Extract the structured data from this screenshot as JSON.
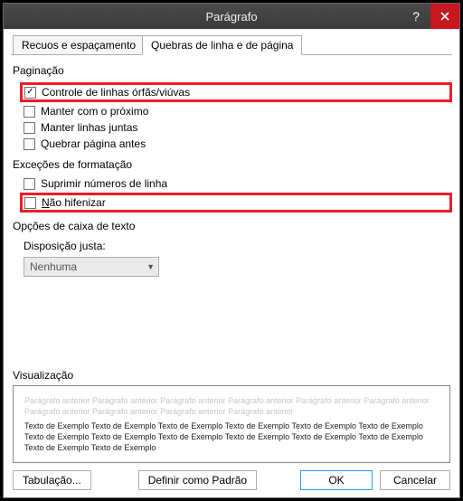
{
  "titlebar": {
    "title": "Parágrafo"
  },
  "tabs": {
    "indent": "Recuos e espaçamento",
    "breaks": "Quebras de linha e de página"
  },
  "section": {
    "pagination": "Paginação",
    "exceptions": "Exceções de formatação",
    "textbox": "Opções de caixa de texto",
    "preview": "Visualização"
  },
  "checkbox": {
    "widow": "Controle de linhas órfãs/viúvas",
    "keepnext": "Manter com o próximo",
    "keeplines": "Manter linhas juntas",
    "pagebreak": "Quebrar página antes",
    "suppress": "Suprimir números de linha",
    "nohyphen_pre": "N",
    "nohyphen_post": "ão hifenizar"
  },
  "textbox": {
    "tightwrap_label": "Disposição justa:",
    "tightwrap_value": "Nenhuma"
  },
  "preview": {
    "ghost": "Parágrafo anterior Parágrafo anterior Parágrafo anterior Parágrafo anterior Parágrafo anterior Parágrafo anterior Parágrafo anterior Parágrafo anterior Parágrafo anterior Parágrafo anterior",
    "sample": "Texto de Exemplo Texto de Exemplo Texto de Exemplo Texto de Exemplo Texto de Exemplo Texto de Exemplo Texto de Exemplo Texto de Exemplo Texto de Exemplo Texto de Exemplo Texto de Exemplo Texto de Exemplo Texto de Exemplo Texto de Exemplo"
  },
  "buttons": {
    "tabs_btn": "Tabulação...",
    "default_btn": "Definir como Padrão",
    "ok": "OK",
    "cancel": "Cancelar"
  }
}
